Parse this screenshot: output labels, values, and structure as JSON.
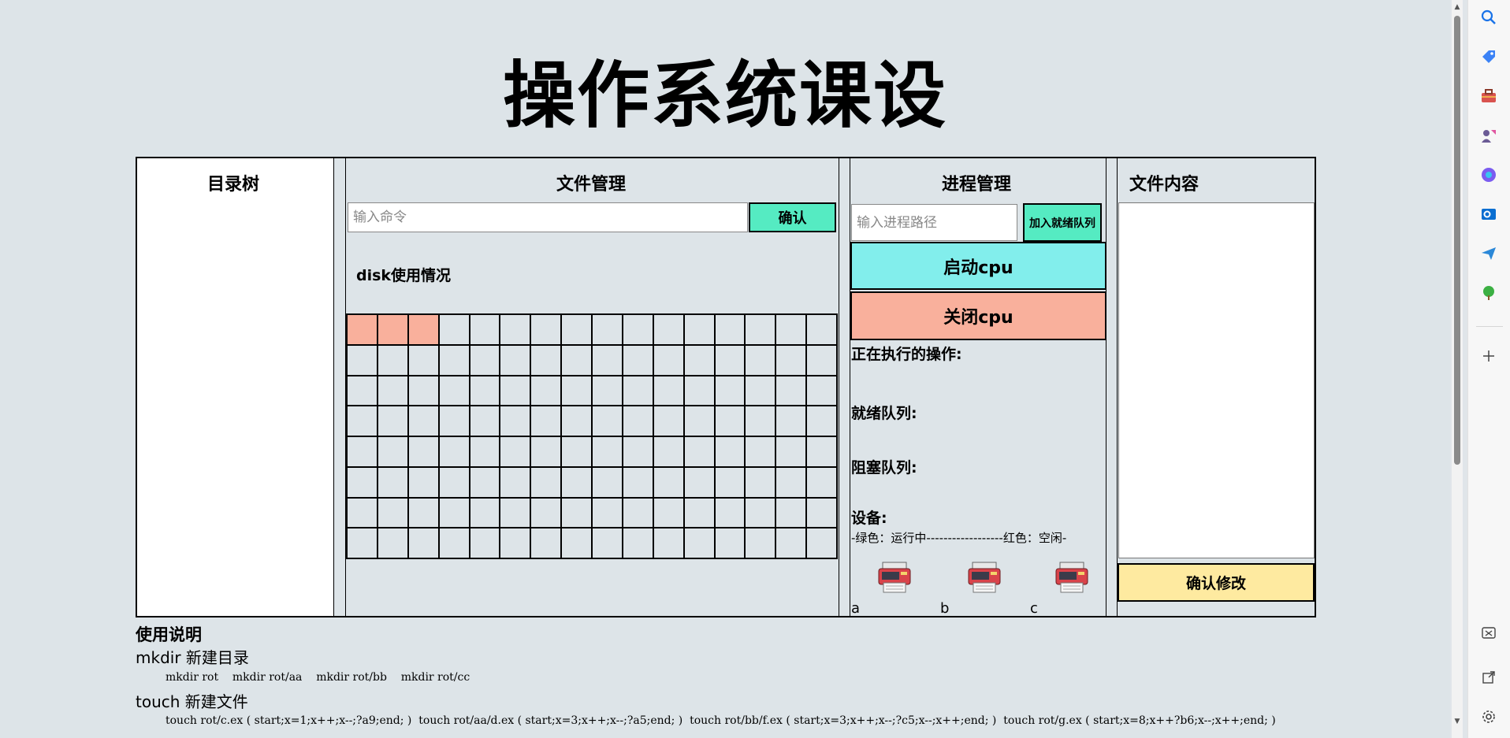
{
  "page": {
    "title": "操作系统课设"
  },
  "dir_panel": {
    "title": "目录树"
  },
  "file_panel": {
    "title": "文件管理",
    "command_placeholder": "输入命令",
    "confirm_label": "确认",
    "disk_label": "disk使用情况",
    "disk": {
      "columns": 16,
      "rows": 8,
      "used_blocks": [
        0,
        1,
        2
      ],
      "used_color": "#f9b09c",
      "free_color": "#dde4e8"
    }
  },
  "proc_panel": {
    "title": "进程管理",
    "path_placeholder": "输入进程路径",
    "ready_button": "加入就绪队列",
    "start_button": "启动cpu",
    "stop_button": "关闭cpu",
    "running_label": "正在执行的操作:",
    "ready_queue_label": "就绪队列:",
    "blocked_queue_label": "阻塞队列:",
    "devices_label": "设备:",
    "legend": "-绿色：运行中------------------红色：空闲-",
    "devices": [
      {
        "name": "a",
        "icon": "printer-icon"
      },
      {
        "name": "b",
        "icon": "printer-icon"
      },
      {
        "name": "c",
        "icon": "printer-icon"
      }
    ]
  },
  "content_panel": {
    "title": "文件内容",
    "save_button": "确认修改"
  },
  "help": {
    "title": "使用说明",
    "mkdir_head": "mkdir 新建目录",
    "mkdir_examples": "mkdir rot    mkdir rot/aa    mkdir rot/bb    mkdir rot/cc",
    "touch_head": "touch 新建文件",
    "touch_examples": "touch rot/c.ex ( start;x=1;x++;x--;?a9;end; )  touch rot/aa/d.ex ( start;x=3;x++;x--;?a5;end; )  touch rot/bb/f.ex ( start;x=3;x++;x--;?c5;x--;x++;end; )  touch rot/g.ex ( start;x=8;x++?b6;x--;x++;end; )"
  },
  "sidebar": {
    "icons": [
      "search-icon",
      "tag-icon",
      "toolbox-icon",
      "games-icon",
      "copilot-icon",
      "outlook-icon",
      "send-icon",
      "tree-icon",
      "add-icon",
      "screenshot-icon",
      "external-link-icon",
      "settings-icon"
    ]
  },
  "colors": {
    "background": "#dde4e8",
    "confirm": "#55ebc2",
    "start_cpu": "#82eeec",
    "stop_cpu": "#f9b09c",
    "save": "#feeaa0"
  }
}
